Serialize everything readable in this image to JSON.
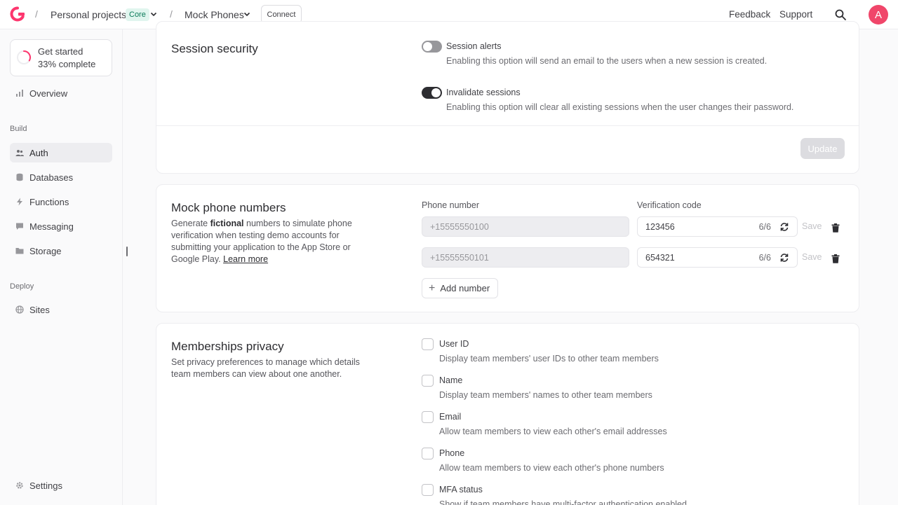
{
  "header": {
    "project": "Personal projects",
    "plan_badge": "Core",
    "subproject": "Mock Phones",
    "connect_label": "Connect",
    "feedback_label": "Feedback",
    "support_label": "Support",
    "avatar_initial": "A",
    "accent_color": "#fd366e"
  },
  "sidebar": {
    "get_started_title": "Get started",
    "get_started_progress": "33% complete",
    "progress_fraction": 0.33,
    "overview_label": "Overview",
    "build_section": "Build",
    "items": [
      {
        "label": "Auth",
        "icon": "users-icon",
        "active": true
      },
      {
        "label": "Databases",
        "icon": "database-icon"
      },
      {
        "label": "Functions",
        "icon": "lightning-icon"
      },
      {
        "label": "Messaging",
        "icon": "chat-icon"
      },
      {
        "label": "Storage",
        "icon": "folder-icon"
      }
    ],
    "deploy_section": "Deploy",
    "sites_label": "Sites",
    "settings_label": "Settings"
  },
  "session_security": {
    "title": "Session security",
    "options": [
      {
        "label": "Session alerts",
        "description": "Enabling this option will send an email to the users when a new session is created.",
        "enabled": false
      },
      {
        "label": "Invalidate sessions",
        "description": "Enabling this option will clear all existing sessions when the user changes their password.",
        "enabled": true
      }
    ],
    "update_label": "Update"
  },
  "mock_phones": {
    "title": "Mock phone numbers",
    "desc_prefix": "Generate ",
    "desc_bold": "fictional",
    "desc_suffix": " numbers to simulate phone verification when testing demo accounts for submitting your application to the App Store or Google Play. ",
    "learn_more": "Learn more",
    "phone_header": "Phone number",
    "code_header": "Verification code",
    "rows": [
      {
        "phone": "+15555550100",
        "code": "123456",
        "count": "6/6",
        "save": "Save"
      },
      {
        "phone": "+15555550101",
        "code": "654321",
        "count": "6/6",
        "save": "Save"
      }
    ],
    "add_label": "Add number"
  },
  "memberships_privacy": {
    "title": "Memberships privacy",
    "description": "Set privacy preferences to manage which details team members can view about one another.",
    "options": [
      {
        "label": "User ID",
        "description": "Display team members' user IDs to other team members",
        "checked": false
      },
      {
        "label": "Name",
        "description": "Display team members' names to other team members",
        "checked": false
      },
      {
        "label": "Email",
        "description": "Allow team members to view each other's email addresses",
        "checked": false
      },
      {
        "label": "Phone",
        "description": "Allow team members to view each other's phone numbers",
        "checked": false
      },
      {
        "label": "MFA status",
        "description": "Show if team members have multi-factor authentication enabled",
        "checked": false
      }
    ]
  }
}
